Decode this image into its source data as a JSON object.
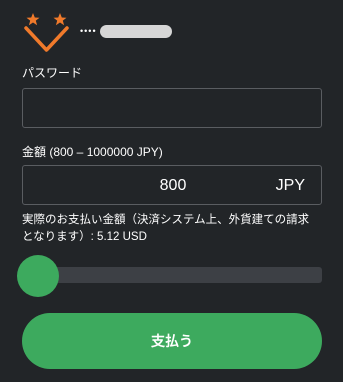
{
  "header": {
    "logo_icon": "star-v-logo-icon",
    "logo_colors": {
      "stars": "#f07a2b",
      "v": "#f07a2b"
    },
    "username_masked": "••••"
  },
  "password": {
    "label": "パスワード",
    "value": "",
    "placeholder": ""
  },
  "amount": {
    "label": "金額 (800 – 1000000 JPY)",
    "value": "800",
    "currency": "JPY"
  },
  "note": {
    "line1": "実際のお支払い金額（決済システム上、外貨建ての請求",
    "line2": "となります）:  5.12 USD"
  },
  "slider": {
    "level": 0
  },
  "pay_button": {
    "label": "支払う"
  },
  "colors": {
    "background": "#222528",
    "accent": "#3daa5e",
    "input_border": "#5a5d61",
    "slider_track": "#3d4045"
  }
}
